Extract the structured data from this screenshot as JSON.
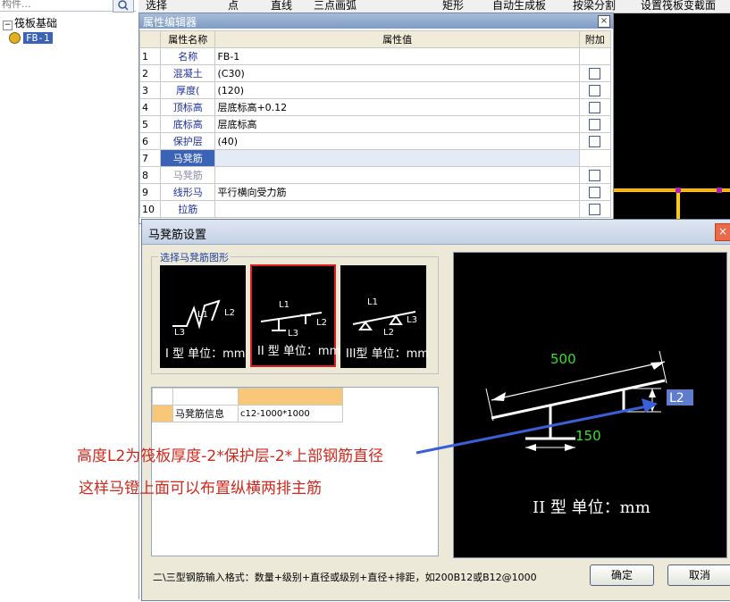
{
  "left_panel": {
    "search_text": "构件...",
    "tree_root": "筏板基础",
    "tree_child": "FB-1"
  },
  "toolbar": {
    "items": [
      "选择",
      "点",
      "直线",
      "三点画弧",
      "矩形",
      "自动生成板",
      "按梁分割",
      "设置筏板变截面"
    ]
  },
  "property_editor": {
    "title": "属性编辑器",
    "headers": {
      "name": "属性名称",
      "value": "属性值",
      "add": "附加"
    },
    "rows": [
      {
        "num": "1",
        "name": "名称",
        "value": "FB-1",
        "check": false
      },
      {
        "num": "2",
        "name": "混凝土",
        "value": "(C30)",
        "check": true
      },
      {
        "num": "3",
        "name": "厚度(",
        "value": "(120)",
        "check": true
      },
      {
        "num": "4",
        "name": "顶标高",
        "value": "层底标高+0.12",
        "check": true
      },
      {
        "num": "5",
        "name": "底标高",
        "value": "层底标高",
        "check": true
      },
      {
        "num": "6",
        "name": "保护层",
        "value": "(40)",
        "check": true
      },
      {
        "num": "7",
        "name": "马凳筋",
        "value": "",
        "check": false
      },
      {
        "num": "8",
        "name": "马凳筋",
        "value": "",
        "check": true
      },
      {
        "num": "9",
        "name": "线形马",
        "value": "平行横向受力筋",
        "check": true
      },
      {
        "num": "10",
        "name": "拉筋",
        "value": "",
        "check": true
      }
    ]
  },
  "dialog": {
    "title": "马凳筋设置",
    "group_label": "选择马凳筋图形",
    "shapes": [
      {
        "caption": "I 型  单位：mm",
        "labels": [
          "L1",
          "L2",
          "L3"
        ]
      },
      {
        "caption": "II 型  单位：mm",
        "labels": [
          "L1",
          "L2",
          "L3"
        ]
      },
      {
        "caption": "III型  单位：mm",
        "labels": [
          "L1",
          "L2",
          "L3"
        ]
      }
    ],
    "info_table": {
      "row_label": "马凳筋信息",
      "row_value": "c12-1000*1000"
    },
    "preview": {
      "dim_top": "500",
      "dim_bottom": "150",
      "dim_side": "L2",
      "caption": "II 型  单位：mm"
    },
    "hint": "二\\三型钢筋输入格式：数量+级别+直径或级别+直径+排距，如200B12或B12@1000",
    "ok_label": "确定",
    "cancel_label": "取消"
  },
  "annotation": {
    "line1": "高度L2为筏板厚度-2*保护层-2*上部钢筋直径",
    "line2": "这样马镫上面可以布置纵横两排主筋"
  },
  "colors": {
    "annotation": "#d0281c",
    "selected_row": "#3a63b5",
    "dim_green": "#36e02c",
    "arrow_blue": "#3a5fd8",
    "cad_yellow": "#ffcc00",
    "cad_magenta": "#b020b0"
  }
}
